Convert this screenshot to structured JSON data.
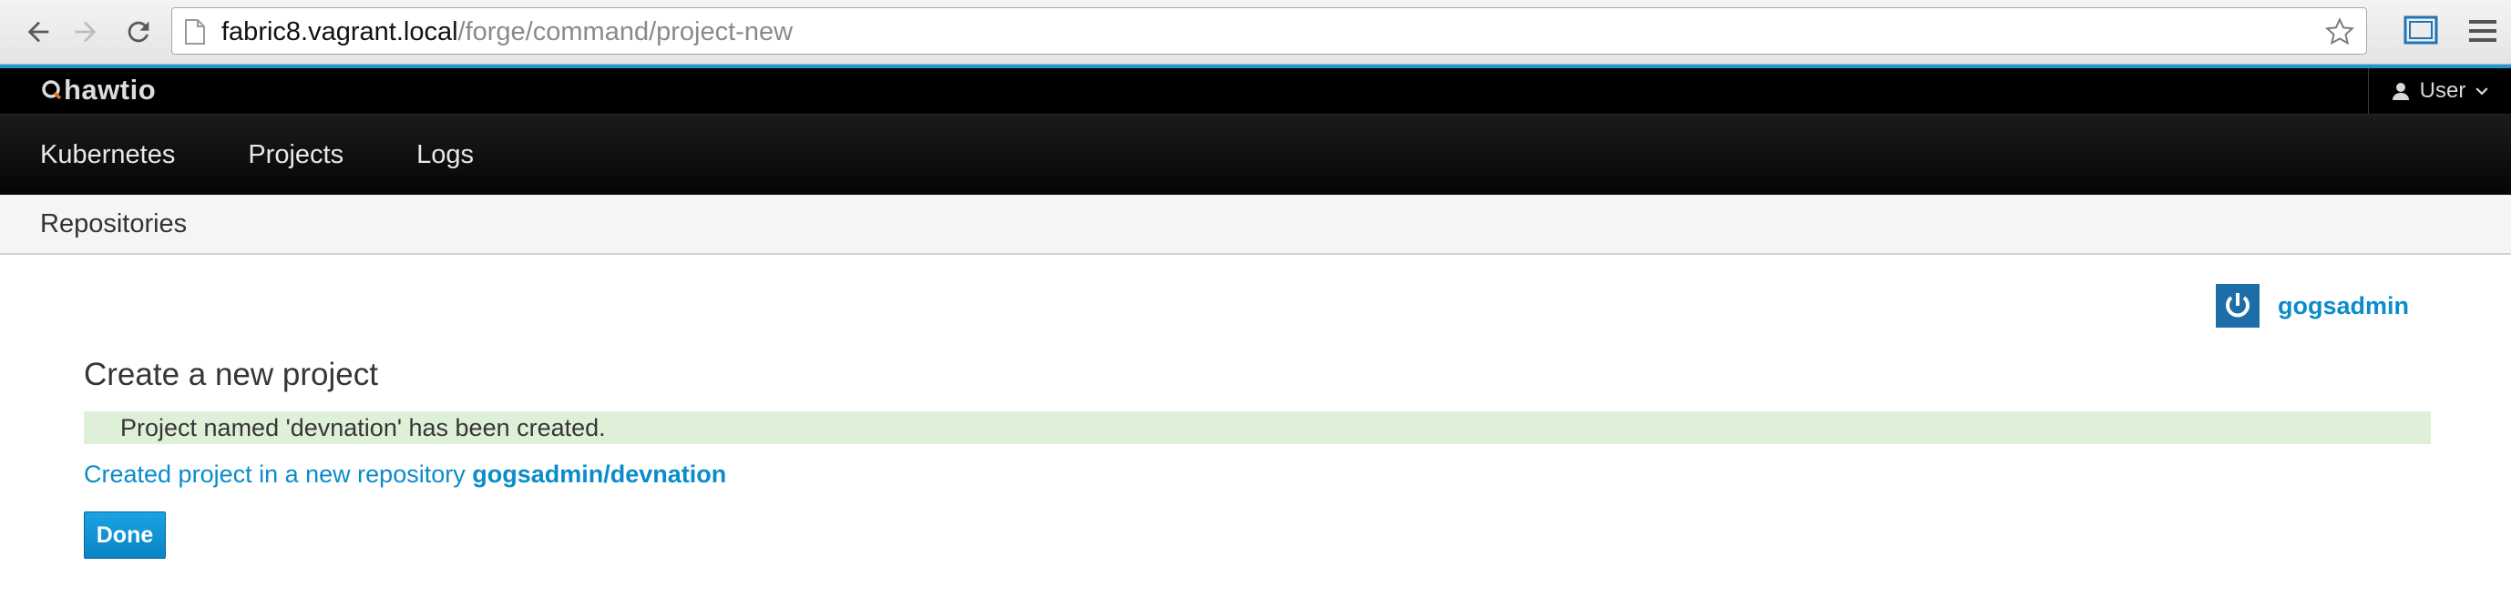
{
  "browser": {
    "url_host": "fabric8.vagrant.local",
    "url_path": "/forge/command/project-new"
  },
  "colors": {
    "accent": "#1f97d4",
    "link": "#0a8cca",
    "success_bg": "#dff0d8",
    "button": "#0a84c4"
  },
  "header": {
    "logo": "hawtio",
    "user_menu_label": "User"
  },
  "main_nav": {
    "items": [
      {
        "label": "Kubernetes"
      },
      {
        "label": "Projects"
      },
      {
        "label": "Logs"
      }
    ]
  },
  "sub_nav": {
    "items": [
      {
        "label": "Repositories"
      }
    ]
  },
  "gogs": {
    "username": "gogsadmin"
  },
  "main": {
    "title": "Create a new project",
    "alert": "Project named 'devnation' has been created.",
    "result_prefix": "Created project in a new repository",
    "repo_link": "gogsadmin/devnation",
    "done_label": "Done"
  },
  "icons": {
    "back": "arrow-left-icon",
    "forward": "arrow-right-icon",
    "reload": "reload-icon",
    "star": "star-icon",
    "cast": "cast-icon",
    "menu": "hamburger-menu-icon",
    "user": "user-icon",
    "power": "power-icon"
  }
}
